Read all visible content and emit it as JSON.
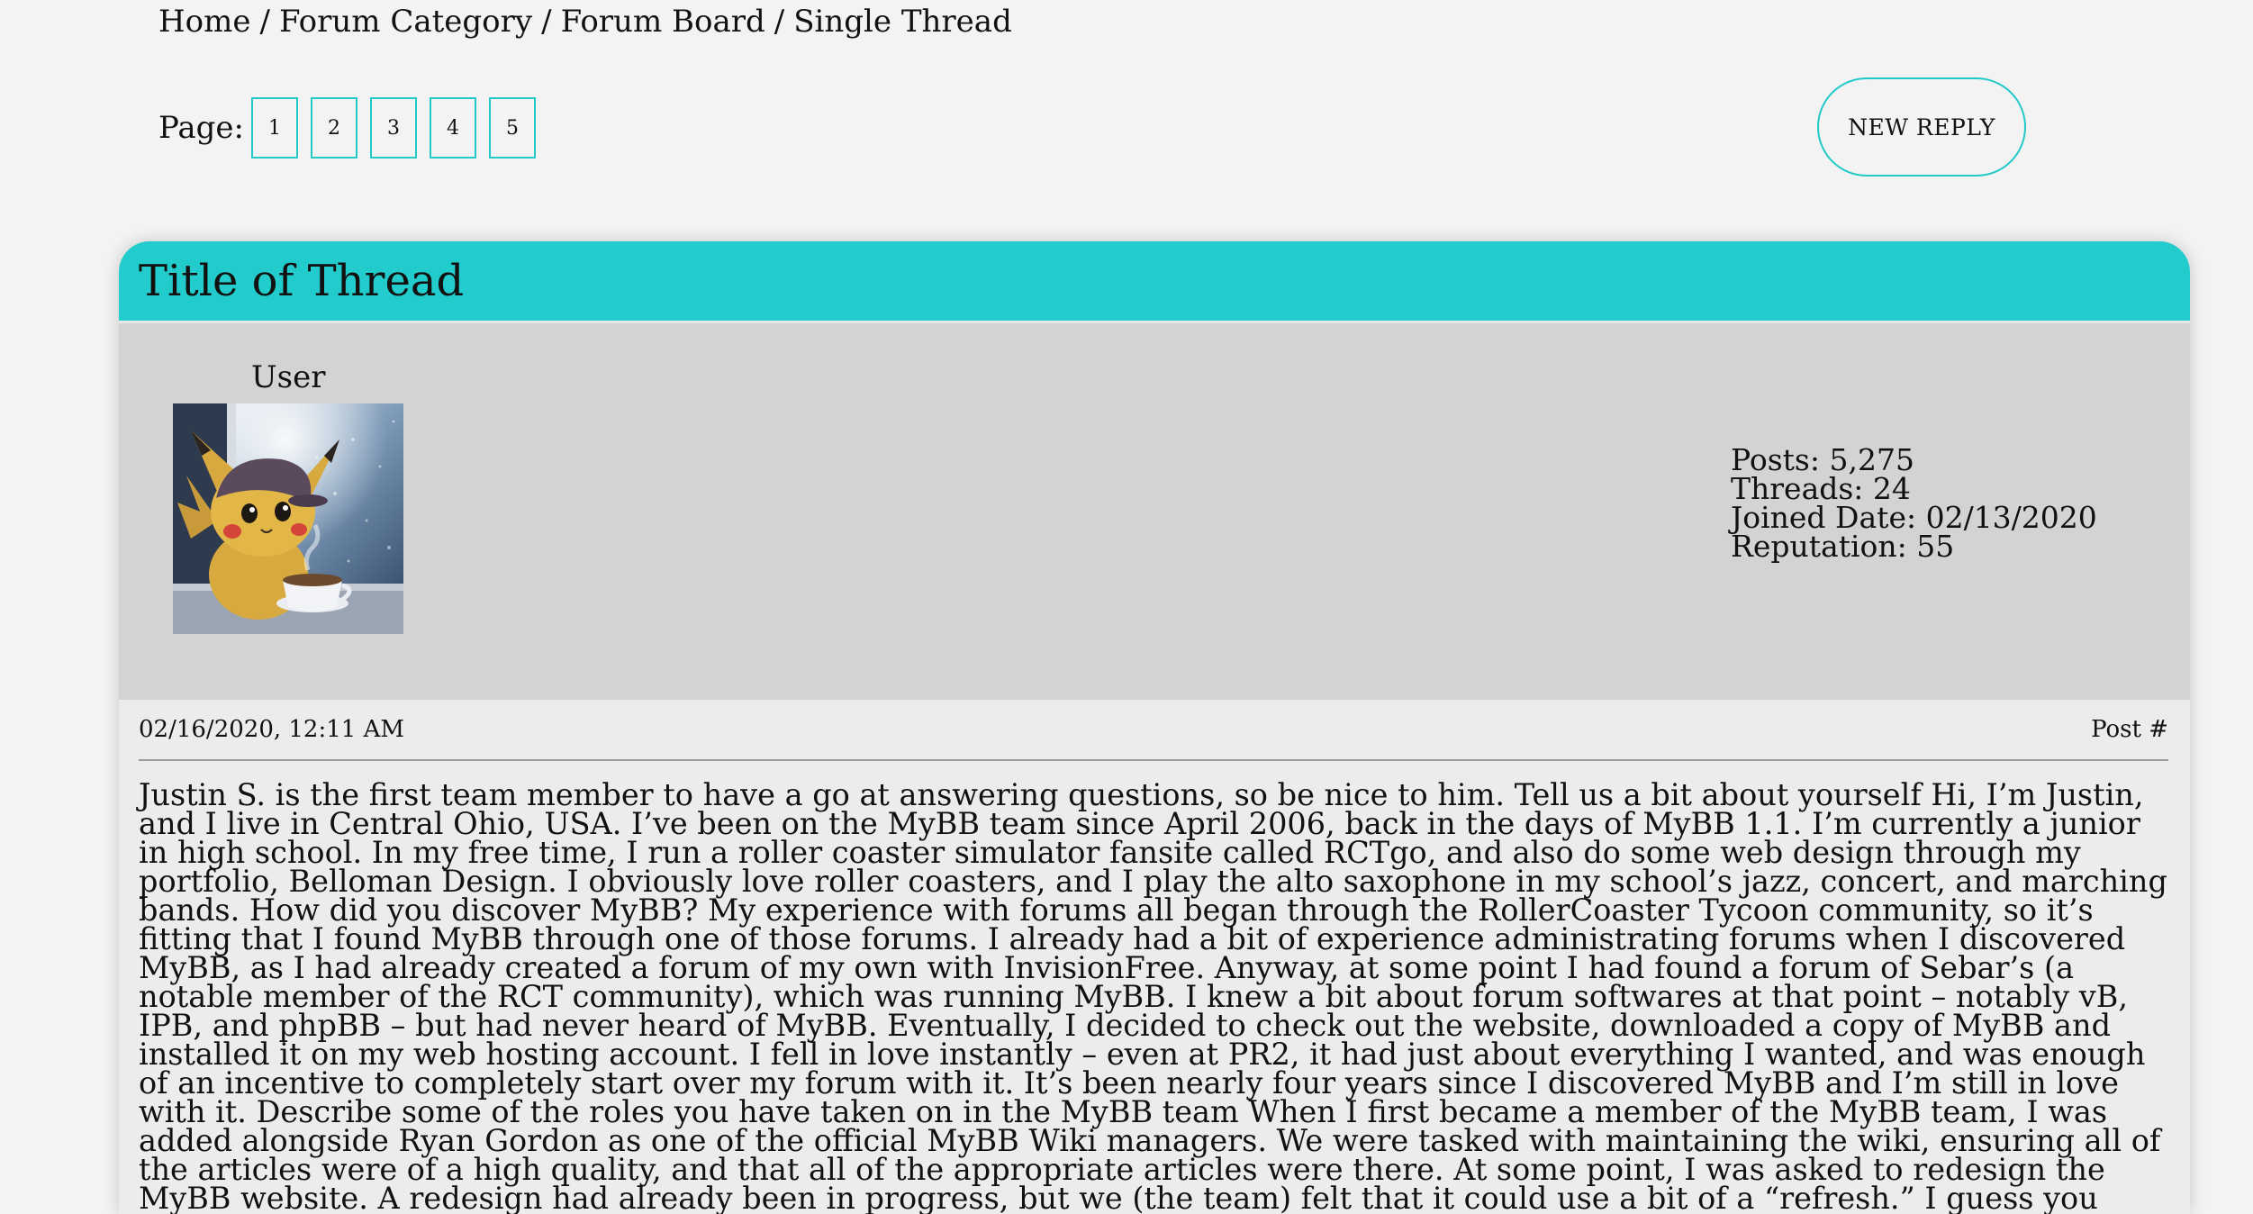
{
  "breadcrumb": {
    "items": [
      "Home",
      "Forum Category",
      "Forum Board",
      "Single Thread"
    ],
    "separator": "/"
  },
  "pagination": {
    "label": "Page:",
    "pages": [
      "1",
      "2",
      "3",
      "4",
      "5"
    ]
  },
  "new_reply": {
    "label": "NEW REPLY"
  },
  "thread": {
    "title": "Title of Thread"
  },
  "user": {
    "name": "User",
    "avatar_icon": "pikachu-with-coffee-avatar",
    "stats": {
      "posts": "Posts: 5,275",
      "threads": "Threads: 24",
      "joined": "Joined Date: 02/13/2020",
      "reputation": "Reputation: 55"
    }
  },
  "post": {
    "date": "02/16/2020, 12:11 AM",
    "number_label": "Post #",
    "body": "Justin S. is the first team member to have a go at answering questions, so be nice to him. Tell us a bit about yourself Hi, I’m Justin, and I live in Central Ohio, USA. I’ve been on the MyBB team since April 2006, back in the days of MyBB 1.1. I’m currently a junior in high school. In my free time, I run a roller coaster simulator fansite called RCTgo, and also do some web design through my portfolio, Belloman Design. I obviously love roller coasters, and I play the alto saxophone in my school’s jazz, concert, and marching bands. How did you discover MyBB? My experience with forums all began through the RollerCoaster Tycoon community, so it’s fitting that I found MyBB through one of those forums. I already had a bit of experience administrating forums when I discovered MyBB, as I had already created a forum of my own with InvisionFree. Anyway, at some point I had found a forum of Sebar’s (a notable member of the RCT community), which was running MyBB. I knew a bit about forum softwares at that point – notably vB, IPB, and phpBB – but had never heard of MyBB. Eventually, I decided to check out the website, downloaded a copy of MyBB and installed it on my web hosting account. I fell in love instantly – even at PR2, it had just about everything I wanted, and was enough of an incentive to completely start over my forum with it. It’s been nearly four years since I discovered MyBB and I’m still in love with it. Describe some of the roles you have taken on in the MyBB team When I first became a member of the MyBB team, I was added alongside Ryan Gordon as one of the official MyBB Wiki managers. We were tasked with maintaining the wiki, ensuring all of the articles were of a high quality, and that all of the appropriate articles were there. At some point, I was asked to redesign the MyBB website. A redesign had already been in progress, but we (the team) felt that it could use a bit of a “refresh.” I guess you could say that is where I began my role as designer. For MyBB 1.4, I created the layouts for countless pages in the new MyBB Admin CP. I’d say roughly two-thirds of the layouts"
  }
}
